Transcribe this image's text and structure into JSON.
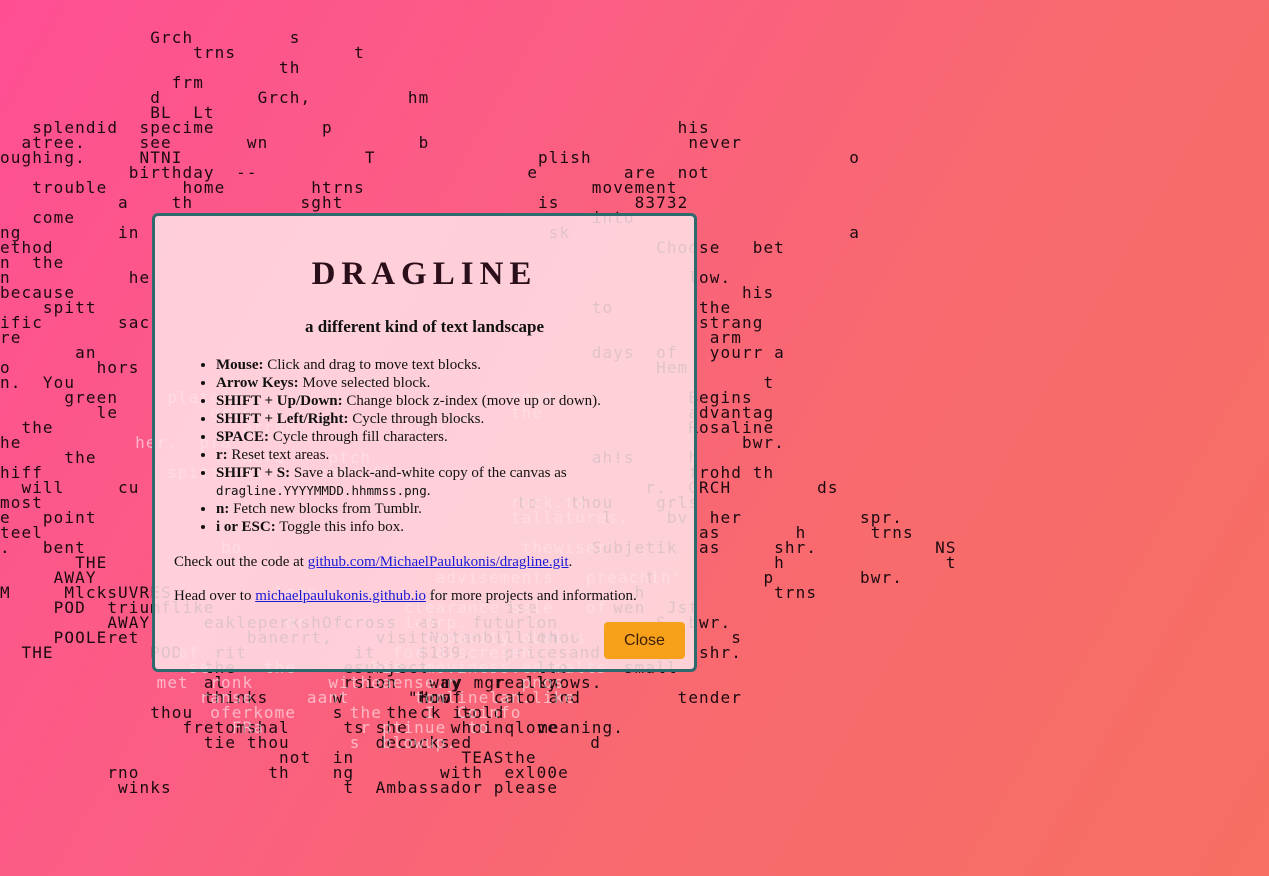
{
  "landscape": {
    "lines_left": [
      "              Grch         s",
      "                  trns           t",
      "                          th",
      "                frm",
      "              d         Grch,         hm",
      "              BL  Lt",
      "   splendid  specime          p",
      "  atree.     see       wn              b",
      "oughing.     NTNI                 T",
      "            birthday  --",
      "   trouble       home        htrns",
      "           a    th          sght",
      "   come",
      "ng         in",
      "ethod",
      "n  the",
      "n           he",
      "because",
      "    spitt",
      "ific       sac",
      "re",
      "       an",
      "o        hors",
      "n.  You",
      "      green",
      "         le",
      "  the",
      "he",
      "      the",
      "hiff",
      "  will     cu",
      "most",
      "e   point",
      "teel",
      ".   bent",
      "       THE",
      "     AWAY",
      "M     MlcksUVRES",
      "     POD  triumflike",
      "          AWAY     eakleperkshOfcross  as   futurlon",
      "     POOLEret          banerrt,    visitNotanbillion",
      "  THE         POD   rit          it    $189.   pricesand",
      "                   the          esubject          lto",
      "                   al           rsion   way   really",
      "                   thinks      w      \"How    cato",
      "              thou             s    the    told",
      "                 fretomshal     ts she    whoinqlove",
      "                   tie thou        decocksed           d",
      "                          not  in          TEASthe",
      "          rno            th    ng        with  exl00e",
      "           winks                t  Ambassador please"
    ],
    "lines_right": [
      "",
      "",
      "",
      "                        his",
      "                         never",
      "           plish                        o",
      "          e        are  not",
      "                movement",
      "           is       83732",
      "                into",
      "            sk                          a",
      "                      Choose   bet",
      "",
      "                         low.",
      "                              his",
      "                to        the",
      "                          strang",
      "                           arm",
      "                days  of   yourr a",
      "                      Hem",
      "                                t",
      "                         Begins",
      "                         advantag",
      "                         Rosaline",
      "                              bwr.",
      "                ah!s     h",
      "                         frohd th",
      "                     r.  GRCH        ds",
      "         to   thou    grls",
      "                 l     bv  her           spr.",
      "                          as       h      trns",
      "                Subjetik  as     shr.           NS",
      "                                 h               t",
      "                     t          p        bwr.",
      "                    h            trns",
      "        ise       wen  Jst",
      "                      S  bwr.",
      "           thou  Lt          s",
      "                          shr.",
      "                   small",
      "  my mgr   knows.",
      "hoof        and         tender",
      "ck is",
      "           meaning.",
      "",
      "",
      "",
      "",
      "",
      "",
      ""
    ],
    "lines_light": [
      "",
      "",
      "",
      "",
      "",
      "",
      "",
      "",
      "",
      "",
      "",
      "",
      "                            chc",
      "          plateis     r.                  road",
      "              grls c                      the",
      "                 arran          Grch",
      "       her.  pra",
      "                there    ptch",
      "          spittoons     sacrifice",
      "",
      "                                          ruck.to",
      "                                          tallatures.",
      "",
      "               bo                          thewiser",
      "",
      "                                   advisements   preachin'",
      "                    lean",
      "                                clearance Sale   of",
      "                     dr         icorp.",
      "                                  capacity.oLal's",
      "           of                  for discreseh",
      "            se     the       his  moviness.en malts",
      "         met  ronk       witheaense.r      pnos",
      "             ranse     aant      tonlinelan.like",
      "              oferkome     the    I  Coinfo",
      "                FRa         r ptinue  to",
      "                           s  blowup.",
      "",
      "",
      "",
      "",
      "",
      "",
      "",
      "",
      "",
      "",
      "",
      ""
    ]
  },
  "info": {
    "title": "DRAGLINE",
    "subtitle": "a different kind of text landscape",
    "controls": [
      {
        "key": "Mouse:",
        "desc": "Click and drag to move text blocks."
      },
      {
        "key": "Arrow Keys:",
        "desc": "Move selected block."
      },
      {
        "key": "SHIFT + Up/Down:",
        "desc": "Change block z-index (move up or down)."
      },
      {
        "key": "SHIFT + Left/Right:",
        "desc": "Cycle through blocks."
      },
      {
        "key": "SPACE:",
        "desc": "Cycle through fill characters."
      },
      {
        "key": "r:",
        "desc": "Reset text areas."
      },
      {
        "key": "SHIFT + S:",
        "desc": "Save a black-and-white copy of the canvas as",
        "code": "dragline.YYYYMMDD.hhmmss.png",
        "after": "."
      },
      {
        "key": "n:",
        "desc": "Fetch new blocks from Tumblr."
      },
      {
        "key": "i or ESC:",
        "desc": "Toggle this info box."
      }
    ],
    "code_prefix": "Check out the code at ",
    "code_link": "github.com/MichaelPaulukonis/dragline.git",
    "code_suffix": ".",
    "site_prefix": "Head over to ",
    "site_link": "michaelpaulukonis.github.io",
    "site_suffix": " for more projects and information.",
    "close_label": "Close"
  }
}
